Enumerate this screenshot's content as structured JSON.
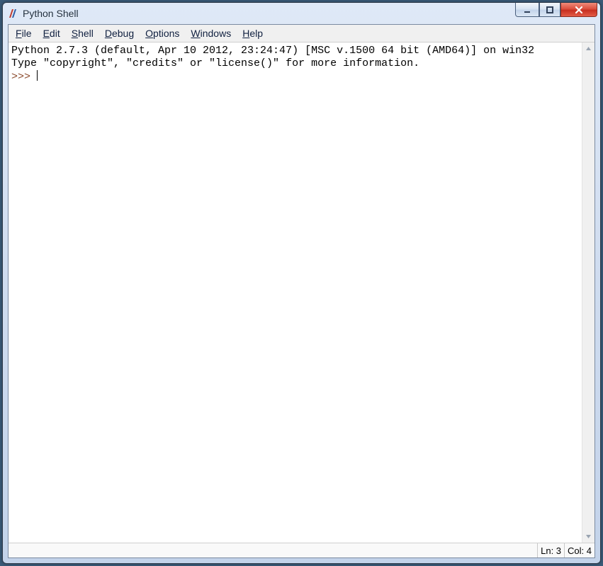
{
  "window": {
    "title": "Python Shell",
    "icon_name": "tk-feather-icon"
  },
  "menu": {
    "items": [
      {
        "accel": "F",
        "rest": "ile"
      },
      {
        "accel": "E",
        "rest": "dit"
      },
      {
        "accel": "S",
        "rest": "hell"
      },
      {
        "accel": "D",
        "rest": "ebug"
      },
      {
        "accel": "O",
        "rest": "ptions"
      },
      {
        "accel": "W",
        "rest": "indows"
      },
      {
        "accel": "H",
        "rest": "elp"
      }
    ]
  },
  "terminal": {
    "banner_line1": "Python 2.7.3 (default, Apr 10 2012, 23:24:47) [MSC v.1500 64 bit (AMD64)] on win32",
    "banner_line2": "Type \"copyright\", \"credits\" or \"license()\" for more information.",
    "prompt": ">>> "
  },
  "status": {
    "line_label": "Ln: 3",
    "col_label": "Col: 4"
  }
}
